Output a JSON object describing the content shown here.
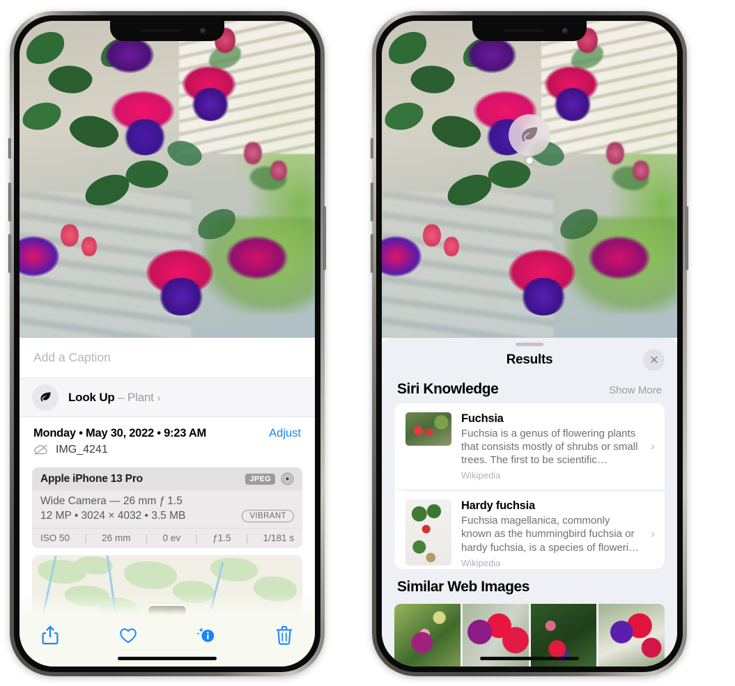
{
  "left_phone": {
    "name": "photos-info-screen",
    "caption": {
      "placeholder": "Add a Caption",
      "value": ""
    },
    "look_up": {
      "icon": "leaf-icon",
      "sparkle_icon": "sparkle-icon",
      "label": "Look Up",
      "dash": " – ",
      "subject": "Plant",
      "chevron": "›"
    },
    "metadata": {
      "weekday": "Monday",
      "date": "May 30, 2022",
      "time": "9:23 AM",
      "separator": "•",
      "date_line": "Monday • May 30, 2022 • 9:23 AM",
      "adjust_label": "Adjust",
      "filename": "IMG_4241",
      "cloud_icon": "cloud-slash-icon"
    },
    "camera_card": {
      "device": "Apple iPhone 13 Pro",
      "format_badge": "JPEG",
      "raw_icon": "raw-aperture-icon",
      "lens_line": "Wide Camera — 26 mm ƒ 1.5",
      "size_line": "12 MP • 3024 × 4032 • 3.5 MB",
      "style_badge": "VIBRANT",
      "stats": [
        "ISO 50",
        "26 mm",
        "0 ev",
        "ƒ1.5",
        "1/181 s"
      ],
      "stat_separator": "|"
    },
    "map": {
      "name": "location-map",
      "pin": "photo-thumbnail-pin"
    },
    "toolbar": [
      {
        "name": "share-button",
        "icon": "share-icon"
      },
      {
        "name": "favorite-button",
        "icon": "heart-icon"
      },
      {
        "name": "info-button",
        "icon": "info-sparkle-icon"
      },
      {
        "name": "delete-button",
        "icon": "trash-icon"
      }
    ],
    "accent_color": "#1a84ff"
  },
  "right_phone": {
    "name": "visual-look-up-results-screen",
    "photo_badge": {
      "icon": "leaf-icon",
      "tooltip": "plant-detected"
    },
    "sheet": {
      "grabber": "sheet-grabber",
      "title": "Results",
      "close_icon": "close-icon",
      "sections": [
        {
          "title": "Siri Knowledge",
          "action": "Show More",
          "items": [
            {
              "title": "Fuchsia",
              "description": "Fuchsia is a genus of flowering plants that consists mostly of shrubs or small trees. The first to be scientific…",
              "source": "Wikipedia",
              "thumbnail": "fuchsia-flowers-thumbnail",
              "chevron": "›"
            },
            {
              "title": "Hardy fuchsia",
              "description": "Fuchsia magellanica, commonly known as the hummingbird fuchsia or hardy fuchsia, is a species of floweri…",
              "source": "Wikipedia",
              "thumbnail": "hardy-fuchsia-specimen-thumbnail",
              "chevron": "›"
            }
          ]
        },
        {
          "title": "Similar Web Images",
          "images": [
            "fuchsia-web-image-1",
            "fuchsia-web-image-2",
            "fuchsia-web-image-3",
            "fuchsia-web-image-4"
          ]
        }
      ]
    },
    "sheet_bg_color": "#eff0f5"
  },
  "device": {
    "notch": "notch",
    "camera": "front-camera",
    "speaker": "earpiece-speaker",
    "buttons": [
      "mute-switch",
      "volume-up-button",
      "volume-down-button",
      "power-button"
    ],
    "home_indicator": "home-indicator"
  }
}
